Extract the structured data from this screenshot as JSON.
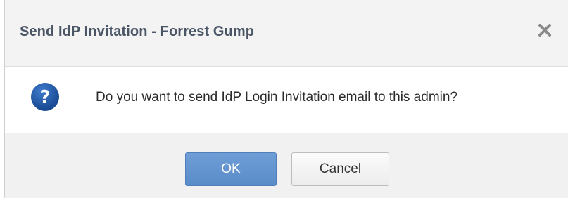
{
  "dialog": {
    "title": "Send IdP Invitation - Forrest Gump",
    "close_icon": "close-icon",
    "message_icon": "question-icon",
    "message": "Do you want to send IdP Login Invitation email to this admin?",
    "ok_label": "OK",
    "cancel_label": "Cancel"
  },
  "colors": {
    "title_text": "#4a5666",
    "question_icon": "#1f5aa6",
    "ok_button": "#5f92cf",
    "footer_bg": "#f1f1f1",
    "titlebar_bg": "#f3f3f3"
  }
}
